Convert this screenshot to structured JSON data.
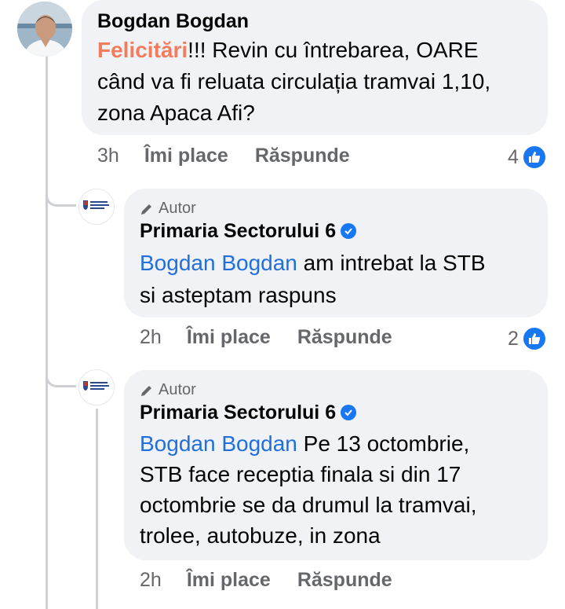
{
  "comments": [
    {
      "author": "Bogdan Bogdan",
      "highlight": "Felicitări",
      "text_after_highlight": "!!! Revin cu întrebarea, OARE",
      "text_line2": "când va fi reluata circulația tramvai 1,10,",
      "text_line3": "zona Apaca Afi?",
      "time": "3h",
      "like_label": "Îmi place",
      "reply_label": "Răspunde",
      "reactions": "4"
    }
  ],
  "replies": [
    {
      "author_badge": "Autor",
      "author": "Primaria Sectorului 6",
      "mention": "Bogdan Bogdan",
      "line1_rest": " am intrebat la STB",
      "line2": "si asteptam raspuns",
      "time": "2h",
      "like_label": "Îmi place",
      "reply_label": "Răspunde",
      "reactions": "2"
    },
    {
      "author_badge": "Autor",
      "author": "Primaria Sectorului 6",
      "mention": "Bogdan Bogdan",
      "line1_rest": " Pe 13 octombrie,",
      "line2": "STB face receptia finala si din 17",
      "line3": "octombrie se da drumul la tramvai,",
      "line4": "trolee, autobuze, in zona",
      "time": "2h",
      "like_label": "Îmi place",
      "reply_label": "Răspunde"
    }
  ],
  "colors": {
    "bubble": "#f0f2f5",
    "mention": "#216fdb",
    "highlight": "#f27c5e",
    "like": "#1877f2"
  },
  "icons": [
    "pencil-icon",
    "verified-badge-icon",
    "like-thumb-icon"
  ]
}
